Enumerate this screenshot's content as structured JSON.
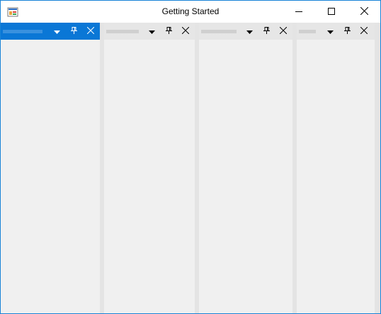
{
  "window": {
    "title": "Getting Started",
    "icon": "app-window-icon",
    "controls": {
      "minimize_icon": "minimize-icon",
      "maximize_icon": "maximize-icon",
      "close_icon": "close-icon"
    }
  },
  "dock_panels": [
    {
      "active": true,
      "icons": [
        "dropdown-arrow-icon",
        "pin-icon",
        "close-icon"
      ]
    },
    {
      "active": false,
      "icons": [
        "dropdown-arrow-icon",
        "pin-icon",
        "close-icon"
      ]
    },
    {
      "active": false,
      "icons": [
        "dropdown-arrow-icon",
        "pin-icon",
        "close-icon"
      ]
    },
    {
      "active": false,
      "icons": [
        "dropdown-arrow-icon",
        "pin-icon",
        "close-icon"
      ]
    }
  ],
  "colors": {
    "active_header": "#0a77d6",
    "inactive_header": "#e6e6e6",
    "panel_background": "#f0f0f0",
    "window_border": "#1883d7"
  }
}
